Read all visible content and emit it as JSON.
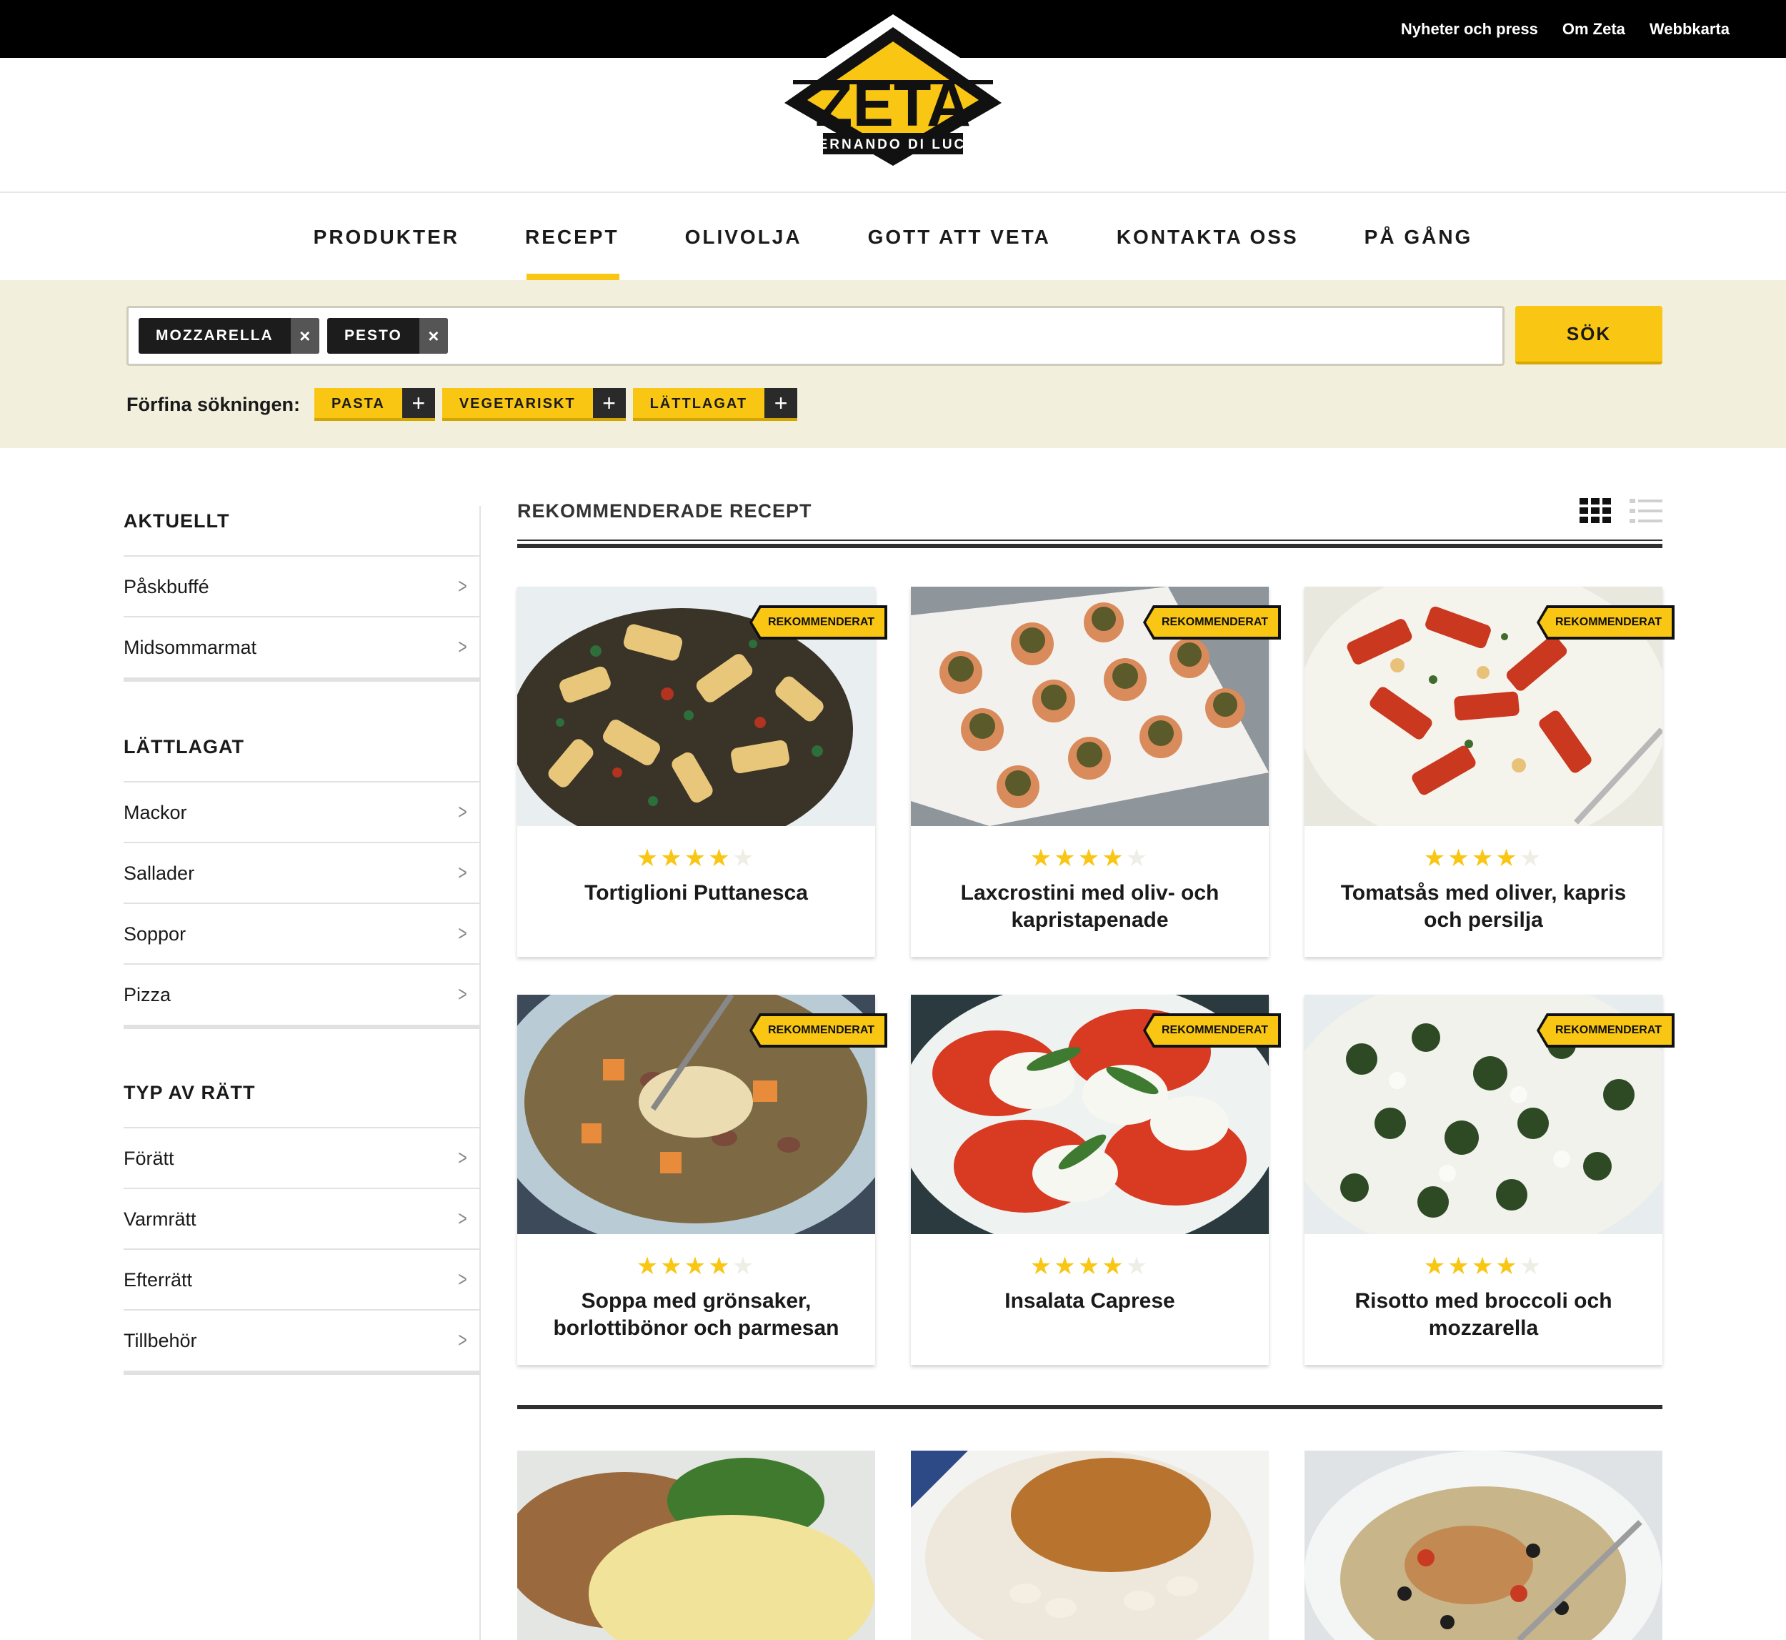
{
  "top_links": [
    "Nyheter och press",
    "Om Zeta",
    "Webbkarta"
  ],
  "logo": {
    "brand": "ZETA",
    "tagline": "FERNANDO DI LUCA"
  },
  "nav": {
    "items": [
      "PRODUKTER",
      "RECEPT",
      "OLIVOLJA",
      "GOTT ATT VETA",
      "KONTAKTA OSS",
      "PÅ GÅNG"
    ],
    "active": "RECEPT"
  },
  "search": {
    "chips": [
      "MOZZARELLA",
      "PESTO"
    ],
    "value": "",
    "button_label": "SÖK",
    "refine_label": "Förfina sökningen:",
    "refine_tags": [
      "PASTA",
      "VEGETARISKT",
      "LÄTTLAGAT"
    ]
  },
  "sidebar": {
    "sections": [
      {
        "heading": "AKTUELLT",
        "items": [
          "Påskbuffé",
          "Midsommarmat"
        ]
      },
      {
        "heading": "LÄTTLAGAT",
        "items": [
          "Mackor",
          "Sallader",
          "Soppor",
          "Pizza"
        ]
      },
      {
        "heading": "TYP AV RÄTT",
        "items": [
          "Förätt",
          "Varmrätt",
          "Efterrätt",
          "Tillbehör"
        ]
      }
    ]
  },
  "main": {
    "heading": "REKOMMENDERADE RECEPT",
    "badge_label": "REKOMMENDERAT",
    "view_modes": [
      "grid",
      "list"
    ],
    "active_view": "grid",
    "recipes": [
      {
        "title": "Tortiglioni Puttanesca",
        "rating": 4,
        "max_rating": 5,
        "recommended": true,
        "image": "pasta-herbs"
      },
      {
        "title": "Laxcrostini med oliv- och kapristapenade",
        "rating": 4,
        "max_rating": 5,
        "recommended": true,
        "image": "crostini-tray"
      },
      {
        "title": "Tomatsås med oliver, kapris och persilja",
        "rating": 4,
        "max_rating": 5,
        "recommended": true,
        "image": "pasta-tomato"
      },
      {
        "title": "Soppa med grönsaker, borlottibönor och parmesan",
        "rating": 4,
        "max_rating": 5,
        "recommended": true,
        "image": "vegetable-soup"
      },
      {
        "title": "Insalata Caprese",
        "rating": 4,
        "max_rating": 5,
        "recommended": true,
        "image": "caprese"
      },
      {
        "title": "Risotto med broccoli och mozzarella",
        "rating": 4,
        "max_rating": 5,
        "recommended": true,
        "image": "risotto-broccoli"
      }
    ],
    "more_images": [
      "chicken-broccoli-mash",
      "roast-chicken-beans",
      "chicken-olives-bowl"
    ]
  },
  "colors": {
    "accent": "#f8c613",
    "topbar": "#000000",
    "band": "#f2efdd",
    "text": "#1a1a1a"
  }
}
